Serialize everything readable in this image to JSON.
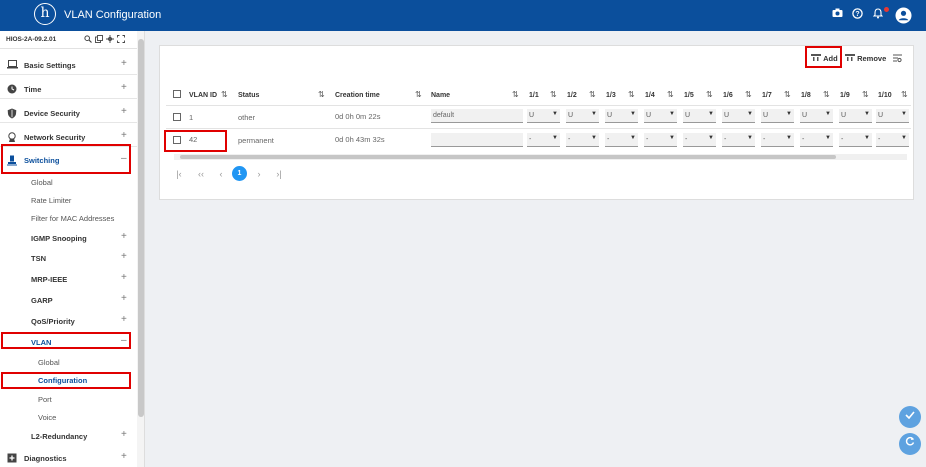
{
  "header": {
    "logo_text": "h",
    "title": "VLAN Configuration",
    "icons": [
      "camera-icon",
      "help-icon",
      "bell-icon",
      "user-icon"
    ]
  },
  "sidebar": {
    "device": "HIOS-2A-09.2.01",
    "device_icons": [
      "search-icon",
      "copy-icon",
      "move-icon",
      "expand-icon"
    ],
    "items": [
      {
        "label": "Basic Settings",
        "icon": "laptop-icon",
        "toggle": "+"
      },
      {
        "label": "Time",
        "icon": "clock-icon",
        "toggle": "+"
      },
      {
        "label": "Device Security",
        "icon": "shield-icon",
        "toggle": "+"
      },
      {
        "label": "Network Security",
        "icon": "network-lock-icon",
        "toggle": "+"
      },
      {
        "label": "Switching",
        "icon": "switch-icon",
        "toggle": "–"
      },
      {
        "label": "Global"
      },
      {
        "label": "Rate Limiter"
      },
      {
        "label": "Filter for MAC Addresses"
      },
      {
        "label": "IGMP Snooping",
        "toggle": "+"
      },
      {
        "label": "TSN",
        "toggle": "+"
      },
      {
        "label": "MRP-IEEE",
        "toggle": "+"
      },
      {
        "label": "GARP",
        "toggle": "+"
      },
      {
        "label": "QoS/Priority",
        "toggle": "+"
      },
      {
        "label": "VLAN",
        "toggle": "–"
      },
      {
        "label": "Global"
      },
      {
        "label": "Configuration"
      },
      {
        "label": "Port"
      },
      {
        "label": "Voice"
      },
      {
        "label": "L2-Redundancy",
        "toggle": "+"
      },
      {
        "label": "Diagnostics",
        "icon": "diagnostics-icon",
        "toggle": "+"
      }
    ]
  },
  "toolbar": {
    "add_label": "Add",
    "remove_label": "Remove"
  },
  "table": {
    "columns": [
      "VLAN ID",
      "Status",
      "Creation time",
      "Name",
      "1/1",
      "1/2",
      "1/3",
      "1/4",
      "1/5",
      "1/6",
      "1/7",
      "1/8",
      "1/9",
      "1/10"
    ],
    "rows": [
      {
        "vlan_id": "1",
        "status": "other",
        "creation_time": "0d 0h 0m 22s",
        "name": "default",
        "ports": [
          "U",
          "U",
          "U",
          "U",
          "U",
          "U",
          "U",
          "U",
          "U",
          "U"
        ]
      },
      {
        "vlan_id": "42",
        "status": "permanent",
        "creation_time": "0d 0h 43m 32s",
        "name": "",
        "ports": [
          "-",
          "-",
          "-",
          "-",
          "-",
          "-",
          "-",
          "-",
          "-",
          "-"
        ]
      }
    ]
  },
  "pagination": {
    "current_page": "1",
    "first": "|‹",
    "prev_group": "‹‹",
    "prev": "‹",
    "next": "›",
    "last": "›|"
  },
  "fabs": {
    "apply_icon": "check-icon",
    "reload_icon": "refresh-icon"
  }
}
